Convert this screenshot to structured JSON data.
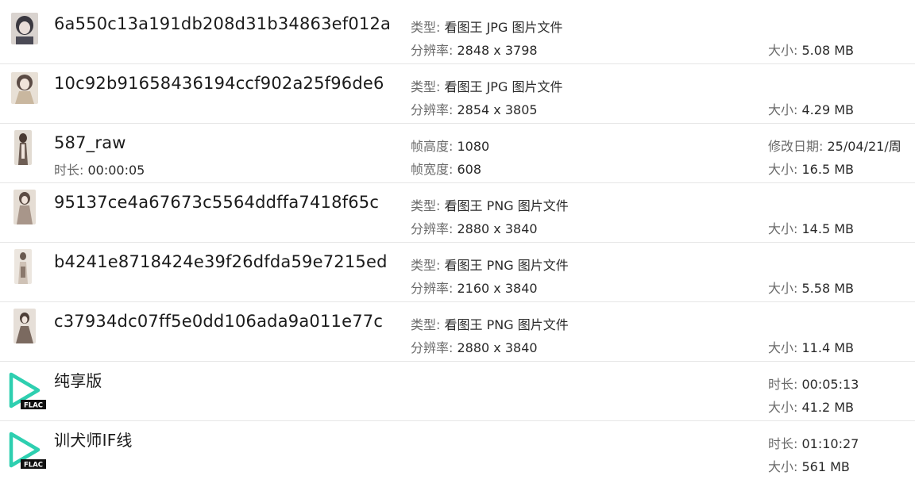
{
  "colors": {
    "play_accent": "#2ecfb0",
    "badge_bg": "#111111",
    "badge_text": "#ffffff"
  },
  "rows": [
    {
      "name": "6a550c13a191db208d31b34863ef012a",
      "type_label": "类型:",
      "type_value": "看图王 JPG 图片文件",
      "res_label": "分辨率:",
      "res_value": "2848 x 3798",
      "size_label": "大小:",
      "size_value": "5.08 MB",
      "icon": "image-thumbnail"
    },
    {
      "name": "10c92b91658436194ccf902a25f96de6",
      "type_label": "类型:",
      "type_value": "看图王 JPG 图片文件",
      "res_label": "分辨率:",
      "res_value": "2854 x 3805",
      "size_label": "大小:",
      "size_value": "4.29 MB",
      "icon": "image-thumbnail"
    },
    {
      "name": "587_raw",
      "duration_label": "时长:",
      "duration_value": "00:00:05",
      "height_label": "帧高度:",
      "height_value": "1080",
      "width_label": "帧宽度:",
      "width_value": "608",
      "date_label": "修改日期:",
      "date_value": "25/04/21/周",
      "size_label": "大小:",
      "size_value": "16.5 MB",
      "icon": "video-thumbnail"
    },
    {
      "name": "95137ce4a67673c5564ddffa7418f65c",
      "type_label": "类型:",
      "type_value": "看图王 PNG 图片文件",
      "res_label": "分辨率:",
      "res_value": "2880 x 3840",
      "size_label": "大小:",
      "size_value": "14.5 MB",
      "icon": "image-thumbnail"
    },
    {
      "name": "b4241e8718424e39f26dfda59e7215ed",
      "type_label": "类型:",
      "type_value": "看图王 PNG 图片文件",
      "res_label": "分辨率:",
      "res_value": "2160 x 3840",
      "size_label": "大小:",
      "size_value": "5.58 MB",
      "icon": "image-thumbnail"
    },
    {
      "name": "c37934dc07ff5e0dd106ada9a011e77c",
      "type_label": "类型:",
      "type_value": "看图王 PNG 图片文件",
      "res_label": "分辨率:",
      "res_value": "2880 x 3840",
      "size_label": "大小:",
      "size_value": "11.4 MB",
      "icon": "image-thumbnail"
    },
    {
      "name": "纯享版",
      "duration_label": "时长:",
      "duration_value": "00:05:13",
      "size_label": "大小:",
      "size_value": "41.2 MB",
      "icon": "flac-play-icon",
      "badge": "FLAC"
    },
    {
      "name": "训犬师IF线",
      "duration_label": "时长:",
      "duration_value": "01:10:27",
      "size_label": "大小:",
      "size_value": "561 MB",
      "icon": "flac-play-icon",
      "badge": "FLAC"
    }
  ]
}
